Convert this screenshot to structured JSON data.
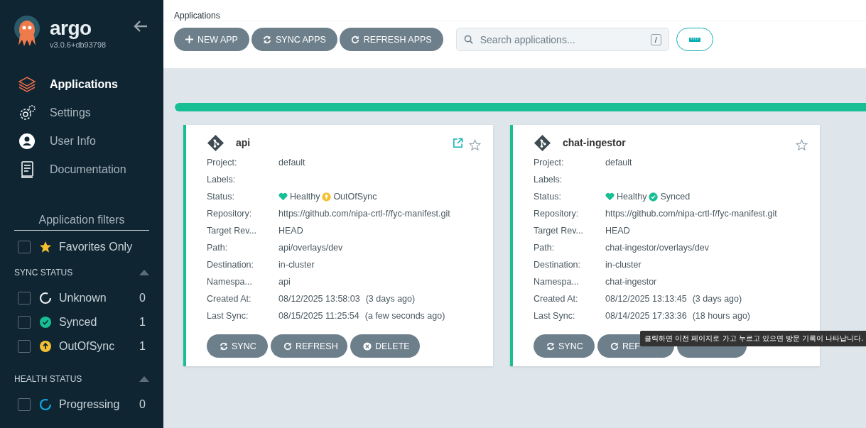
{
  "sidebar": {
    "brand": "argo",
    "version": "v3.0.6+db93798",
    "nav": [
      {
        "label": "Applications",
        "selected": true
      },
      {
        "label": "Settings",
        "selected": false
      },
      {
        "label": "User Info",
        "selected": false
      },
      {
        "label": "Documentation",
        "selected": false
      }
    ],
    "filters_title": "Application filters",
    "favorites": {
      "label": "Favorites Only",
      "checked": false
    },
    "groups": [
      {
        "title": "SYNC STATUS",
        "expanded": true,
        "items": [
          {
            "label": "Unknown",
            "kind": "unknown",
            "count": "0",
            "checked": false
          },
          {
            "label": "Synced",
            "kind": "synced",
            "count": "1",
            "checked": false
          },
          {
            "label": "OutOfSync",
            "kind": "outofsync",
            "count": "1",
            "checked": false
          }
        ]
      },
      {
        "title": "HEALTH STATUS",
        "expanded": true,
        "items": [
          {
            "label": "Progressing",
            "kind": "progressing",
            "count": "0",
            "checked": false
          }
        ]
      }
    ]
  },
  "breadcrumb": "Applications",
  "toolbar": {
    "buttons": [
      {
        "label": "NEW APP"
      },
      {
        "label": "SYNC APPS"
      },
      {
        "label": "REFRESH APPS"
      }
    ],
    "search": {
      "placeholder": "Search applications...",
      "shortcut": "/"
    }
  },
  "progress": {
    "level": 1
  },
  "apps": [
    {
      "name": "api",
      "external_link": true,
      "favorite": false,
      "fields": [
        {
          "label": "Project:",
          "value": "default"
        },
        {
          "label": "Labels:"
        },
        {
          "label": "Status:",
          "health": "Healthy",
          "sync": "OutOfSync",
          "in_sync": false
        },
        {
          "label": "Repository:",
          "value": "https://github.com/nipa-crtl-f/fyc-manifest.git"
        },
        {
          "label": "Target Rev...",
          "value": "HEAD"
        },
        {
          "label": "Path:",
          "value": "api/overlays/dev"
        },
        {
          "label": "Destination:",
          "value": "in-cluster"
        },
        {
          "label": "Namespa...",
          "value": "api"
        },
        {
          "label": "Created At:",
          "value": "08/12/2025 13:58:03",
          "note": "(3 days ago)"
        },
        {
          "label": "Last Sync:",
          "value": "08/15/2025 11:25:54",
          "note": "(a few seconds ago)"
        }
      ],
      "buttons": [
        {
          "kind": "sync",
          "label": "SYNC"
        },
        {
          "kind": "refresh",
          "label": "REFRESH"
        },
        {
          "kind": "delete",
          "label": "DELETE"
        }
      ]
    },
    {
      "name": "chat-ingestor",
      "external_link": false,
      "favorite": false,
      "fields": [
        {
          "label": "Project:",
          "value": "default"
        },
        {
          "label": "Labels:"
        },
        {
          "label": "Status:",
          "health": "Healthy",
          "sync": "Synced",
          "in_sync": true
        },
        {
          "label": "Repository:",
          "value": "https://github.com/nipa-crtl-f/fyc-manifest.git"
        },
        {
          "label": "Target Rev...",
          "value": "HEAD"
        },
        {
          "label": "Path:",
          "value": "chat-ingestor/overlays/dev"
        },
        {
          "label": "Destination:",
          "value": "in-cluster"
        },
        {
          "label": "Namespa...",
          "value": "chat-ingestor"
        },
        {
          "label": "Created At:",
          "value": "08/12/2025 13:13:45",
          "note": "(3 days ago)"
        },
        {
          "label": "Last Sync:",
          "value": "08/14/2025 17:33:36",
          "note": "(18 hours ago)"
        }
      ],
      "buttons": [
        {
          "kind": "sync",
          "label": "SYNC"
        },
        {
          "kind": "refresh",
          "label": "REF"
        },
        {
          "kind": "delete"
        }
      ]
    }
  ],
  "tooltip": "클릭하면 이전 페이지로 가고 누르고 있으면 방문 기록이 나타납니다."
}
